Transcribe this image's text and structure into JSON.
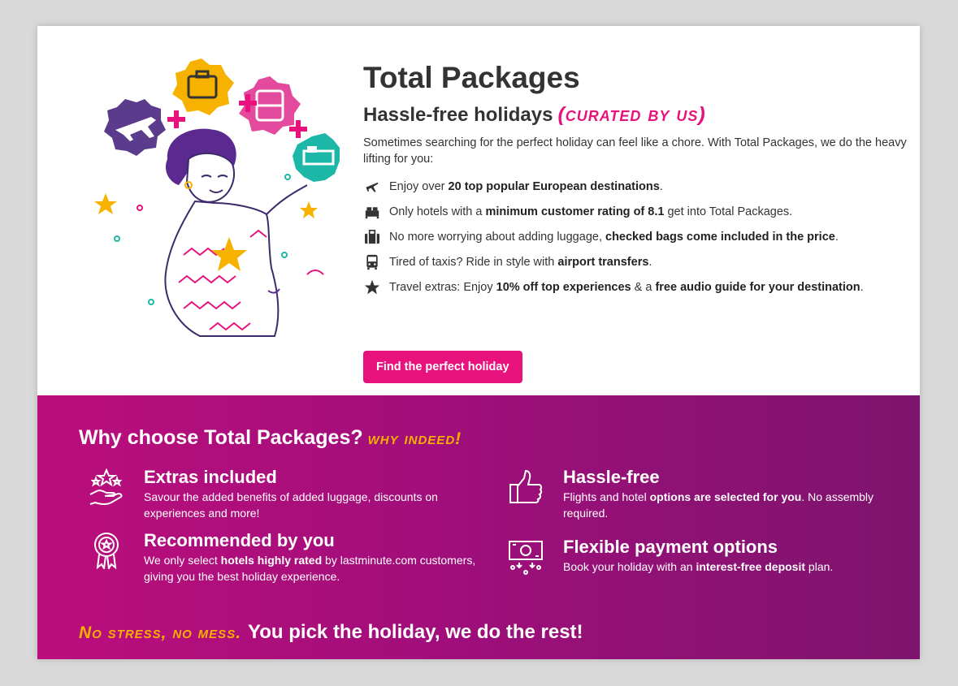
{
  "hero": {
    "title": "Total Packages",
    "subtitle": "Hassle-free holidays",
    "subtitle_script": "(curated by us)",
    "intro": "Sometimes searching for the perfect holiday can feel like a chore. With Total Packages, we do the heavy lifting for you:",
    "features": [
      {
        "icon": "plane-icon",
        "pre": "Enjoy over ",
        "bold": "20 top popular European destinations",
        "post": "."
      },
      {
        "icon": "bed-icon",
        "pre": "Only hotels with a ",
        "bold": "minimum customer rating of 8.1",
        "post": " get into Total Packages."
      },
      {
        "icon": "luggage-icon",
        "pre": "No more worrying about adding luggage, ",
        "bold": "checked bags come included in the price",
        "post": "."
      },
      {
        "icon": "bus-icon",
        "pre": "Tired of taxis? Ride in style with ",
        "bold": "airport transfers",
        "post": "."
      },
      {
        "icon": "star-icon",
        "pre": "Travel extras: Enjoy ",
        "bold": "10% off top experiences",
        "mid": " & a ",
        "bold2": "free audio guide for your destination",
        "post": "."
      }
    ],
    "cta_label": "Find the perfect holiday"
  },
  "why": {
    "heading": "Why choose Total Packages?",
    "heading_script": "why indeed!",
    "benefits": [
      {
        "icon": "hand-stars-icon",
        "title": "Extras included",
        "text_pre": "Savour the added benefits of added luggage, discounts on experiences and more!",
        "text_bold": "",
        "text_post": ""
      },
      {
        "icon": "thumbs-up-icon",
        "title": "Hassle-free",
        "text_pre": "Flights and hotel ",
        "text_bold": "options are selected for you",
        "text_post": ". No assembly required."
      },
      {
        "icon": "award-badge-icon",
        "title": "Recommended by you",
        "text_pre": "We only select ",
        "text_bold": "hotels highly rated",
        "text_post": " by lastminute.com customers, giving you the best holiday experience."
      },
      {
        "icon": "payment-icon",
        "title": "Flexible payment options",
        "text_pre": "Book your holiday with an ",
        "text_bold": "interest-free deposit",
        "text_post": " plan."
      }
    ],
    "tagline_script": "No stress, no mess.",
    "tagline": "You pick the holiday, we do the rest!"
  },
  "colors": {
    "brand_pink": "#e8127c",
    "accent_yellow": "#f7b200",
    "gradient_start": "#bb0e7c",
    "gradient_end": "#7d146e"
  }
}
